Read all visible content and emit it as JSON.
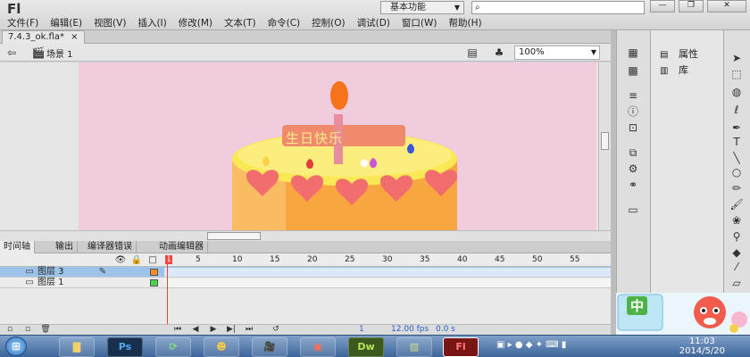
{
  "app": {
    "logo": "Fl"
  },
  "menus": [
    "文件(F)",
    "编辑(E)",
    "视图(V)",
    "插入(I)",
    "修改(M)",
    "文本(T)",
    "命令(C)",
    "控制(O)",
    "调试(D)",
    "窗口(W)",
    "帮助(H)"
  ],
  "workspace": {
    "label": "基本功能",
    "search_placeholder": ""
  },
  "window_controls": {
    "minimize": "—",
    "restore": "❐",
    "close": "✕"
  },
  "document": {
    "tab_label": "7.4.3_ok.fla*",
    "tab_close": "×",
    "scene_label": "场景 1",
    "zoom": "100%"
  },
  "cake": {
    "sign_text": "生日快乐",
    "colors": {
      "sign": "#f08a6c",
      "flame": "#f7731a",
      "top": "#fbe855",
      "body": "#f8a640",
      "heart": "#f26d6d"
    }
  },
  "timeline": {
    "tabs": [
      "时间轴",
      "输出",
      "编译器错误",
      "动画编辑器"
    ],
    "frame_numbers": [
      "1",
      "5",
      "10",
      "15",
      "20",
      "25",
      "30",
      "35",
      "40",
      "45",
      "50",
      "55"
    ],
    "layers": [
      {
        "name": "图层 3",
        "selected": true,
        "color": "#ff8a2a"
      },
      {
        "name": "图层 1",
        "selected": false,
        "color": "#4ed44e"
      }
    ],
    "footer": {
      "frame": "1",
      "fps": "12.00 fps",
      "time": "0.0 s"
    }
  },
  "panels": {
    "properties": "属性",
    "library": "库"
  },
  "taskbar": {
    "apps": [
      "Ps",
      "Dw",
      "Fl"
    ],
    "tray_ime": "中",
    "time": "11:03",
    "date": "2014/5/20"
  }
}
